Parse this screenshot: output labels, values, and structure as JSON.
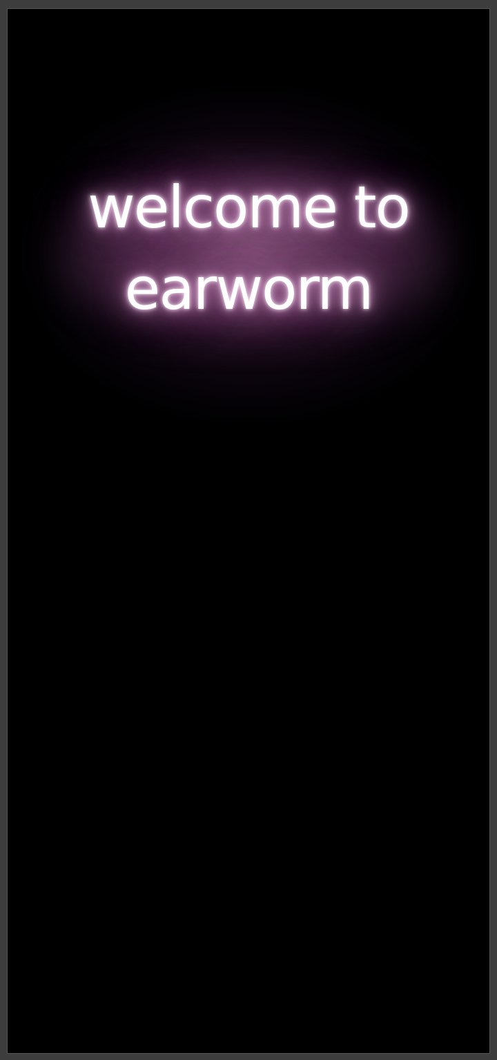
{
  "welcome": {
    "line1": "welcome to",
    "line2": "earworm"
  },
  "colors": {
    "background": "#000000",
    "text": "#ffffff",
    "glow": "#c98cbf",
    "frame": "#3d3d3d"
  }
}
